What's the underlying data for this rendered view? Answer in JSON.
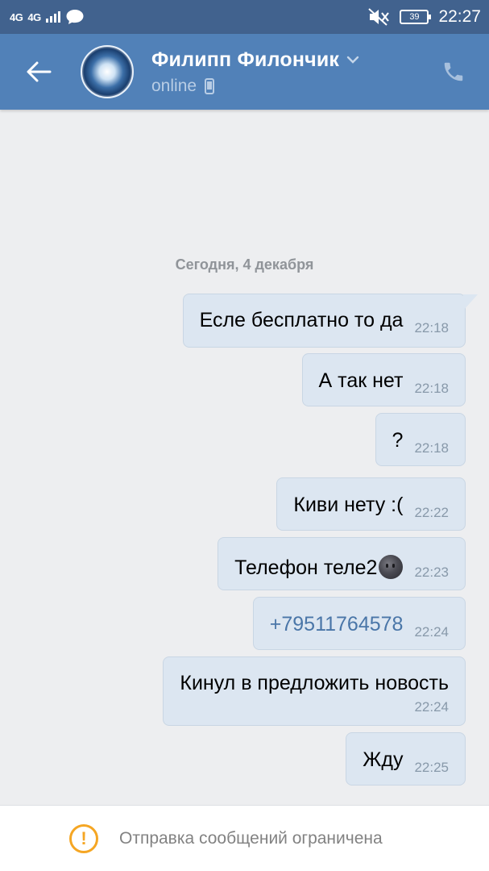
{
  "status_bar": {
    "network_1": "4G",
    "network_2": "4G",
    "battery": "39",
    "time": "22:27"
  },
  "header": {
    "back_icon": "arrow-left-icon",
    "name": "Филипп Филончик",
    "status": "online",
    "call_icon": "phone-icon"
  },
  "chat": {
    "date_separator": "Сегодня, 4 декабря",
    "messages": [
      {
        "text": "Есле бесплатно то да",
        "time": "22:18"
      },
      {
        "text": "А так нет",
        "time": "22:18"
      },
      {
        "text": "?",
        "time": "22:18"
      },
      {
        "text": "Киви нету :(",
        "time": "22:22"
      },
      {
        "text": "Телефон теле2",
        "emoji": "new-moon-face",
        "time": "22:23"
      },
      {
        "text": "+79511764578",
        "time": "22:24",
        "is_link": true
      },
      {
        "text": "Кинул в предложить новость",
        "time": "22:24"
      },
      {
        "text": "Жду",
        "time": "22:25"
      }
    ]
  },
  "footer": {
    "warning_icon": "exclamation-circle-icon",
    "text": "Отправка сообщений ограничена"
  },
  "colors": {
    "status_bar": "#41628e",
    "header": "#5181b8",
    "background": "#edeef0",
    "bubble": "#dce6f1",
    "link": "#4a76a8",
    "warning": "#f5a623"
  }
}
